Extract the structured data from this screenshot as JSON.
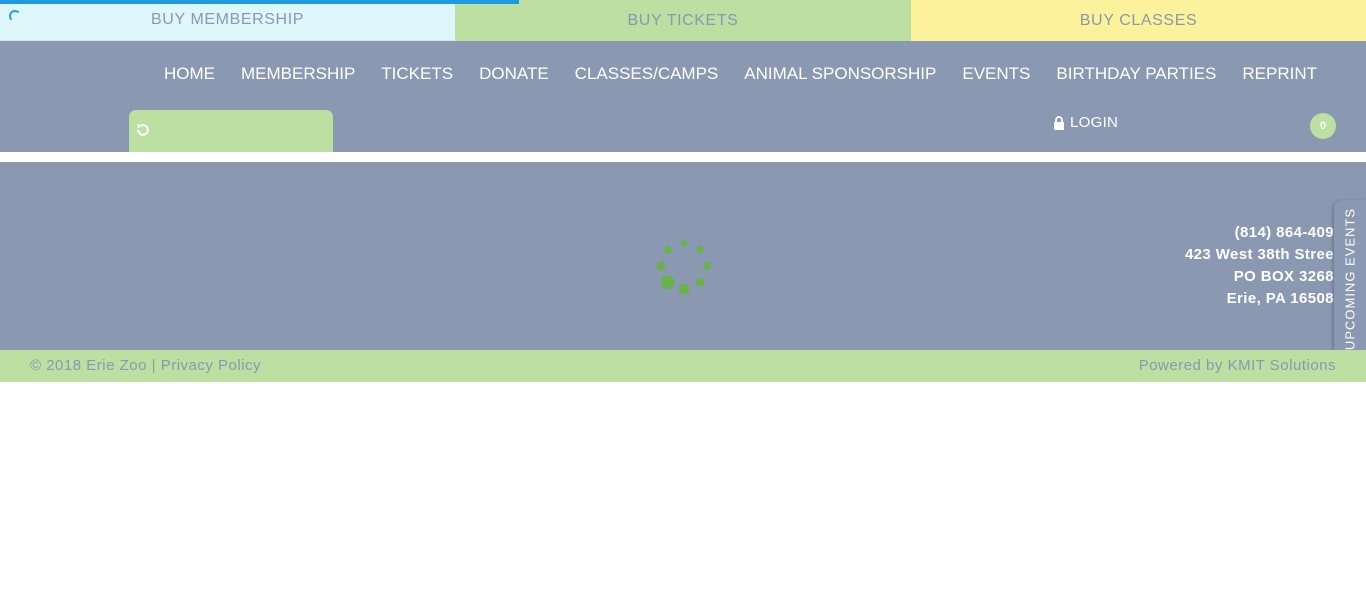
{
  "loading": {
    "progress_percent": 38
  },
  "topbar": {
    "membership_label": "BUY MEMBERSHIP",
    "tickets_label": "BUY TICKETS",
    "classes_label": "BUY CLASSES"
  },
  "nav": {
    "items": [
      {
        "label": "HOME"
      },
      {
        "label": "MEMBERSHIP"
      },
      {
        "label": "TICKETS"
      },
      {
        "label": "DONATE"
      },
      {
        "label": "CLASSES/CAMPS"
      },
      {
        "label": "ANIMAL SPONSORSHIP"
      },
      {
        "label": "EVENTS"
      },
      {
        "label": "BIRTHDAY PARTIES"
      },
      {
        "label": "REPRINT"
      }
    ]
  },
  "header": {
    "login_label": "LOGIN",
    "cart_count": "0"
  },
  "contact": {
    "phone": "(814) 864-409",
    "street": "423 West 38th Stree",
    "po_box": "PO BOX 3268",
    "city": "Erie, PA 16508"
  },
  "events_tab": {
    "label": "UPCOMING EVENTS"
  },
  "footer": {
    "copyright": "© 2018 Erie Zoo |",
    "privacy_label": "Privacy Policy",
    "powered_by": "Powered by KMIT Solutions"
  },
  "colors": {
    "header_bg": "#8b98b2",
    "green_accent": "#bcdfa2",
    "light_blue": "#def7fb",
    "yellow": "#fbf29b",
    "progress_blue": "#1e9be0",
    "loader_green": "#6ab04c"
  },
  "icons": {
    "refresh": "refresh-icon",
    "lock": "lock-icon",
    "loader": "loading-spinner-icon"
  }
}
